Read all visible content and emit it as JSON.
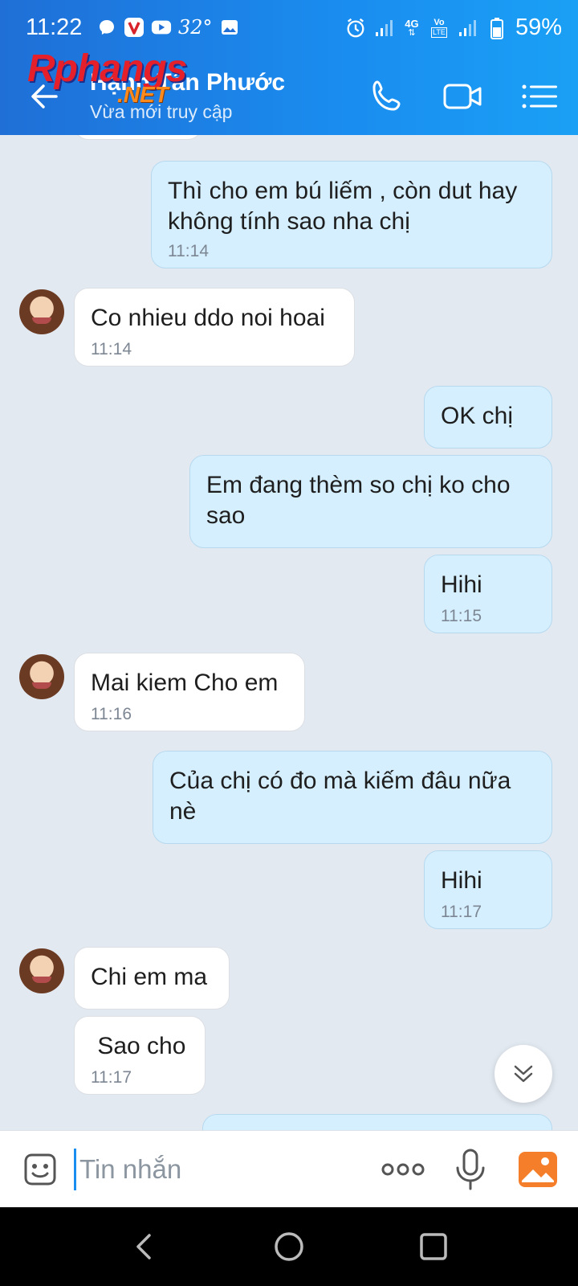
{
  "status_bar": {
    "time": "11:22",
    "temperature": "32°",
    "battery": "59%",
    "network": "4G",
    "lte": "LTE"
  },
  "watermark": {
    "main": "Rphangs",
    "sub": ".NET"
  },
  "header": {
    "contact_name": "Hạnh Tấn Phước",
    "contact_status": "Vừa mới truy cập"
  },
  "messages": [
    {
      "dir": "out",
      "text": "Thì cho em bú liếm , còn dut hay không tính sao nha chị",
      "time": "11:14"
    },
    {
      "dir": "in",
      "text": "Co nhieu ddo noi hoai",
      "time": "11:14"
    },
    {
      "dir": "out",
      "text": "OK chị",
      "time": ""
    },
    {
      "dir": "out",
      "text": "Em đang thèm so chị ko cho sao",
      "time": ""
    },
    {
      "dir": "out",
      "text": "Hihi",
      "time": "11:15"
    },
    {
      "dir": "in",
      "text": "Mai kiem Cho em",
      "time": "11:16"
    },
    {
      "dir": "out",
      "text": "Của chị có đo mà kiếm đâu nữa nè",
      "time": ""
    },
    {
      "dir": "out",
      "text": "Hihi",
      "time": "11:17"
    },
    {
      "dir": "in",
      "text": "Chi em ma",
      "time": ""
    },
    {
      "dir": "in",
      "text": " Sao cho",
      "time": "11:17"
    }
  ],
  "input": {
    "placeholder": "Tin nhắn"
  },
  "colors": {
    "header_blue": "#1a8df0",
    "bubble_out": "#d5efff",
    "bubble_in": "#ffffff",
    "chat_bg": "#e2e9f1"
  }
}
